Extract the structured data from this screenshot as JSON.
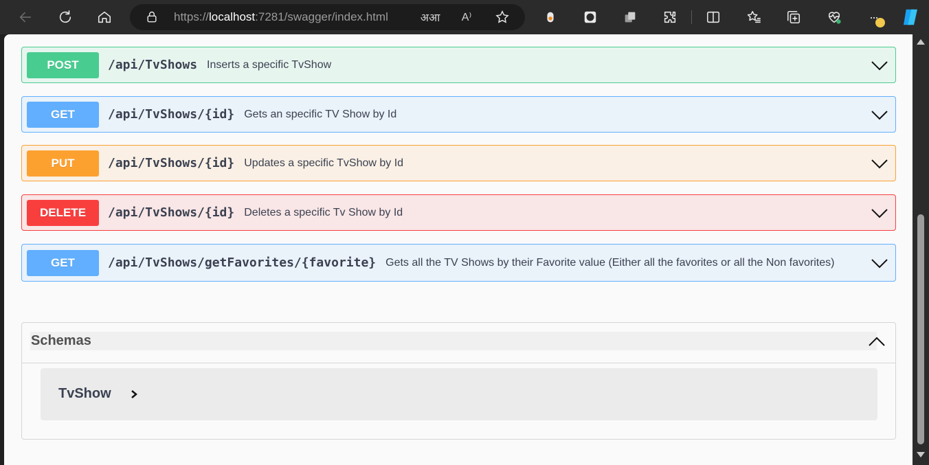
{
  "browser": {
    "url_prefix": "https://",
    "url_host": "localhost",
    "url_rest": ":7281/swagger/index.html",
    "read_aloud_glyph": "A⁾",
    "translate_glyph": "अआ",
    "more_glyph": "···"
  },
  "operations": [
    {
      "method": "POST",
      "path": "/api/TvShows",
      "summary": "Inserts a specific TvShow"
    },
    {
      "method": "GET",
      "path": "/api/TvShows/{id}",
      "summary": "Gets an specific TV Show by Id"
    },
    {
      "method": "PUT",
      "path": "/api/TvShows/{id}",
      "summary": "Updates a specific TvShow by Id"
    },
    {
      "method": "DELETE",
      "path": "/api/TvShows/{id}",
      "summary": "Deletes a specific Tv Show by Id"
    },
    {
      "method": "GET",
      "path": "/api/TvShows/getFavorites/{favorite}",
      "summary": "Gets all the TV Shows by their Favorite value (Either all the favorites or all the Non favorites)"
    }
  ],
  "schemas": {
    "title": "Schemas",
    "models": [
      {
        "name": "TvShow"
      }
    ]
  },
  "colors": {
    "post": "#49cc90",
    "get": "#61affe",
    "put": "#fca130",
    "delete": "#f93e3e"
  }
}
